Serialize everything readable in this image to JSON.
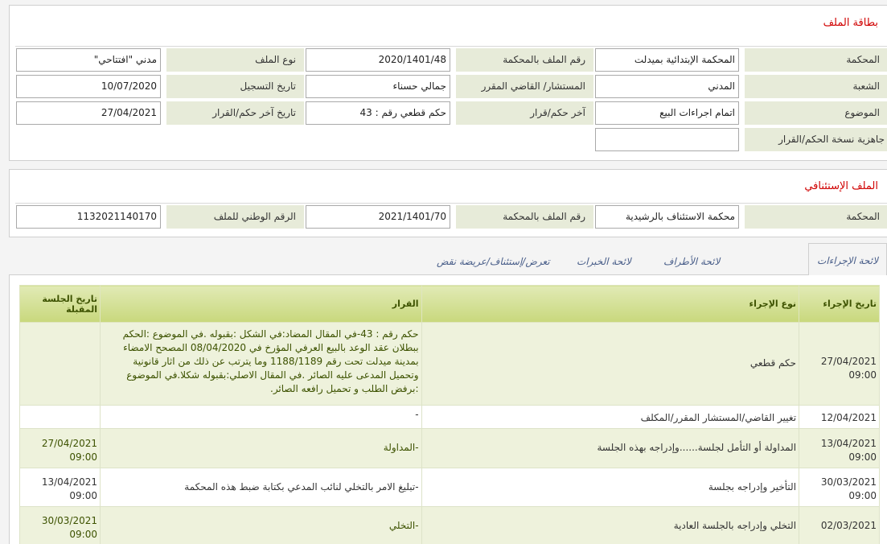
{
  "file_card": {
    "title": "بطاقة الملف",
    "rows": [
      {
        "l1": "المحكمة",
        "v1": "المحكمة الإبتدائية بميدلت",
        "l2": "رقم الملف بالمحكمة",
        "v2": "2020/1401/48",
        "l3": "نوع الملف",
        "v3": "مدني \"افتتاحي\""
      },
      {
        "l1": "الشعبة",
        "v1": "المدني",
        "l2": "المستشار/ القاضي المقرر",
        "v2": "جمالي حسناء",
        "l3": "تاريخ التسجيل",
        "v3": "10/07/2020"
      },
      {
        "l1": "الموضوع",
        "v1": "اتمام اجراءات البيع",
        "l2": "آخر حكم/قرار",
        "v2": "حكم قطعي رقم : 43",
        "l3": "تاريخ آخر حكم/القرار",
        "v3": "27/04/2021"
      }
    ],
    "ready_label": "جاهزية نسخة الحكم/القرار",
    "ready_value": ""
  },
  "appeal_file": {
    "title": "الملف الإستئنافي",
    "court_label": "المحكمة",
    "court_value": "محكمة الاستئناف بالرشيدية",
    "number_label": "رقم الملف بالمحكمة",
    "number_value": "2021/1401/70",
    "national_label": "الرقم الوطني للملف",
    "national_value": "1132021140170"
  },
  "tabs": [
    {
      "label": "لائحة الإجراءات",
      "active": true
    },
    {
      "label": "لائحة الأطراف",
      "active": false
    },
    {
      "label": "لائحة الخبرات",
      "active": false
    },
    {
      "label": "تعرض/إستئناف/عريضة نقض",
      "active": false
    }
  ],
  "procedures": {
    "headers": {
      "date": "تاريخ الإجراء",
      "type": "نوع الإجراء",
      "decision": "القرار",
      "next": "تاريخ الجلسة المقبلة"
    },
    "rows": [
      {
        "date": "27/04/2021",
        "time": "09:00",
        "type": "حكم قطعي",
        "decision": "حكم رقم : 43-في المقال المضاد:في الشكل :بقبوله .في الموضوع :الحكم ببطلان عقد الوعد بالبيع العرفي المؤرخ في 08/04/2020 المصحح الامضاء بمدينة ميدلت تحت رقم 1188/1189 وما يترتب عن ذلك من اثار قانونية وتحميل المدعى عليه الصائر .في المقال الاصلي:بقبوله شكلا.في الموضوع :برفض الطلب و تحميل رافعه الصائر.",
        "next_date": "",
        "next_time": ""
      },
      {
        "date": "12/04/2021",
        "time": "",
        "type": "تغيير القاضي/المستشار المقرر/المكلف",
        "decision": "-",
        "next_date": "",
        "next_time": ""
      },
      {
        "date": "13/04/2021",
        "time": "09:00",
        "type": "المداولة أو التأمل لجلسة......وإدراجه بهذه الجلسة",
        "decision": "-المداولة",
        "next_date": "27/04/2021",
        "next_time": "09:00"
      },
      {
        "date": "30/03/2021",
        "time": "09:00",
        "type": "التأخير وإدراجه بجلسة",
        "decision": "-تبليغ الامر بالتخلي لنائب المدعي بكتابة ضبط هذه المحكمة",
        "next_date": "13/04/2021",
        "next_time": "09:00"
      },
      {
        "date": "02/03/2021",
        "time": "",
        "type": "التخلي وإدراجه بالجلسة العادية",
        "decision": "-التخلي",
        "next_date": "30/03/2021",
        "next_time": "09:00"
      }
    ]
  },
  "colors": {
    "title_red": "#d00000",
    "label_bg": "#e7ebd9",
    "header_green": "#c8d87c",
    "row_alt": "#eef2dc",
    "tab_link": "#4a5f8a"
  }
}
